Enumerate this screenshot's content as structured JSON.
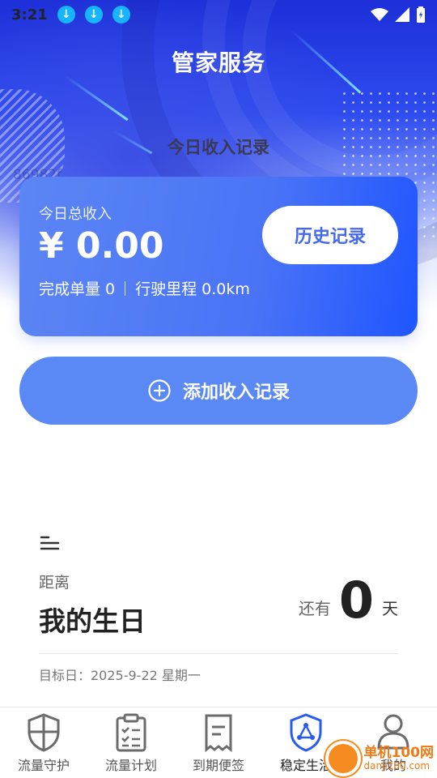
{
  "status_bar": {
    "time": "3:21",
    "download_count": 3
  },
  "header": {
    "title": "管家服务",
    "subtitle": "今日收入记录",
    "ghost_text": "86982f"
  },
  "income_card": {
    "label": "今日总收入",
    "amount": "¥ 0.00",
    "orders": "完成单量 0",
    "mileage": "行驶里程 0.0km",
    "history_button": "历史记录"
  },
  "add_record_button": "添加收入记录",
  "countdown": {
    "distance_label": "距离",
    "event_name": "我的生日",
    "remain_prefix": "还有",
    "remain_days": "0",
    "remain_suffix": "天",
    "target_date": "目标日：2025-9-22 星期一"
  },
  "tabs": [
    {
      "label": "流量守护",
      "icon": "shield-icon"
    },
    {
      "label": "流量计划",
      "icon": "clipboard-icon"
    },
    {
      "label": "到期便签",
      "icon": "receipt-icon"
    },
    {
      "label": "稳定生活",
      "icon": "stability-shield-icon",
      "active": true
    },
    {
      "label": "我的",
      "icon": "user-icon"
    }
  ],
  "watermark": {
    "cn": "单机100网",
    "en": "danji100.com"
  },
  "colors": {
    "accent": "#4a73f6",
    "header_deep": "#1d2fd8",
    "active_tab": "#2a5bf0"
  }
}
